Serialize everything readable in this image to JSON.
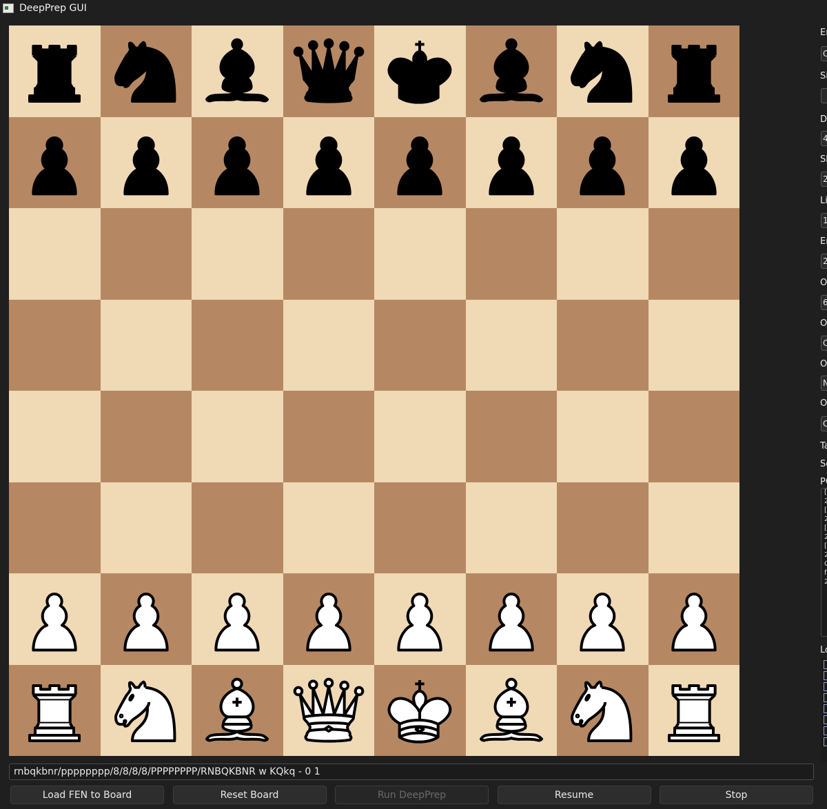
{
  "window": {
    "title": "DeepPrep GUI"
  },
  "board": {
    "light_color": "#f0d9b5",
    "dark_color": "#b58863",
    "rows": [
      [
        "bR",
        "bN",
        "bB",
        "bQ",
        "bK",
        "bB",
        "bN",
        "bR"
      ],
      [
        "bP",
        "bP",
        "bP",
        "bP",
        "bP",
        "bP",
        "bP",
        "bP"
      ],
      [
        "",
        "",
        "",
        "",
        "",
        "",
        "",
        ""
      ],
      [
        "",
        "",
        "",
        "",
        "",
        "",
        "",
        ""
      ],
      [
        "",
        "",
        "",
        "",
        "",
        "",
        "",
        ""
      ],
      [
        "",
        "",
        "",
        "",
        "",
        "",
        "",
        ""
      ],
      [
        "wP",
        "wP",
        "wP",
        "wP",
        "wP",
        "wP",
        "wP",
        "wP"
      ],
      [
        "wR",
        "wN",
        "wB",
        "wQ",
        "wK",
        "wB",
        "wN",
        "wR"
      ]
    ]
  },
  "fen_input": {
    "value": "rnbqkbnr/pppppppp/8/8/8/8/PPPPPPPP/RNBQKBNR w KQkq - 0 1"
  },
  "buttons": [
    {
      "id": "load-fen-button",
      "label": "Load FEN to Board",
      "enabled": true
    },
    {
      "id": "reset-board-button",
      "label": "Reset Board",
      "enabled": true
    },
    {
      "id": "run-deepprep-button",
      "label": "Run DeepPrep",
      "enabled": false
    },
    {
      "id": "resume-button",
      "label": "Resume",
      "enabled": true
    },
    {
      "id": "stop-button",
      "label": "Stop",
      "enabled": true
    }
  ],
  "side_panel": {
    "labels": [
      "Er",
      "Si",
      "De",
      "Sh",
      "Li",
      "Er",
      "O",
      "O",
      "O",
      "O",
      "Ta",
      "Se",
      "PG",
      "Lo"
    ],
    "fields": [
      "C",
      "",
      "4",
      "2",
      "1",
      "2",
      "6",
      "C",
      "N",
      "C"
    ],
    "pgn_lines": [
      "[",
      "2",
      "[",
      "2",
      "[",
      "2",
      "[",
      "2",
      "C",
      "f",
      "2"
    ]
  }
}
